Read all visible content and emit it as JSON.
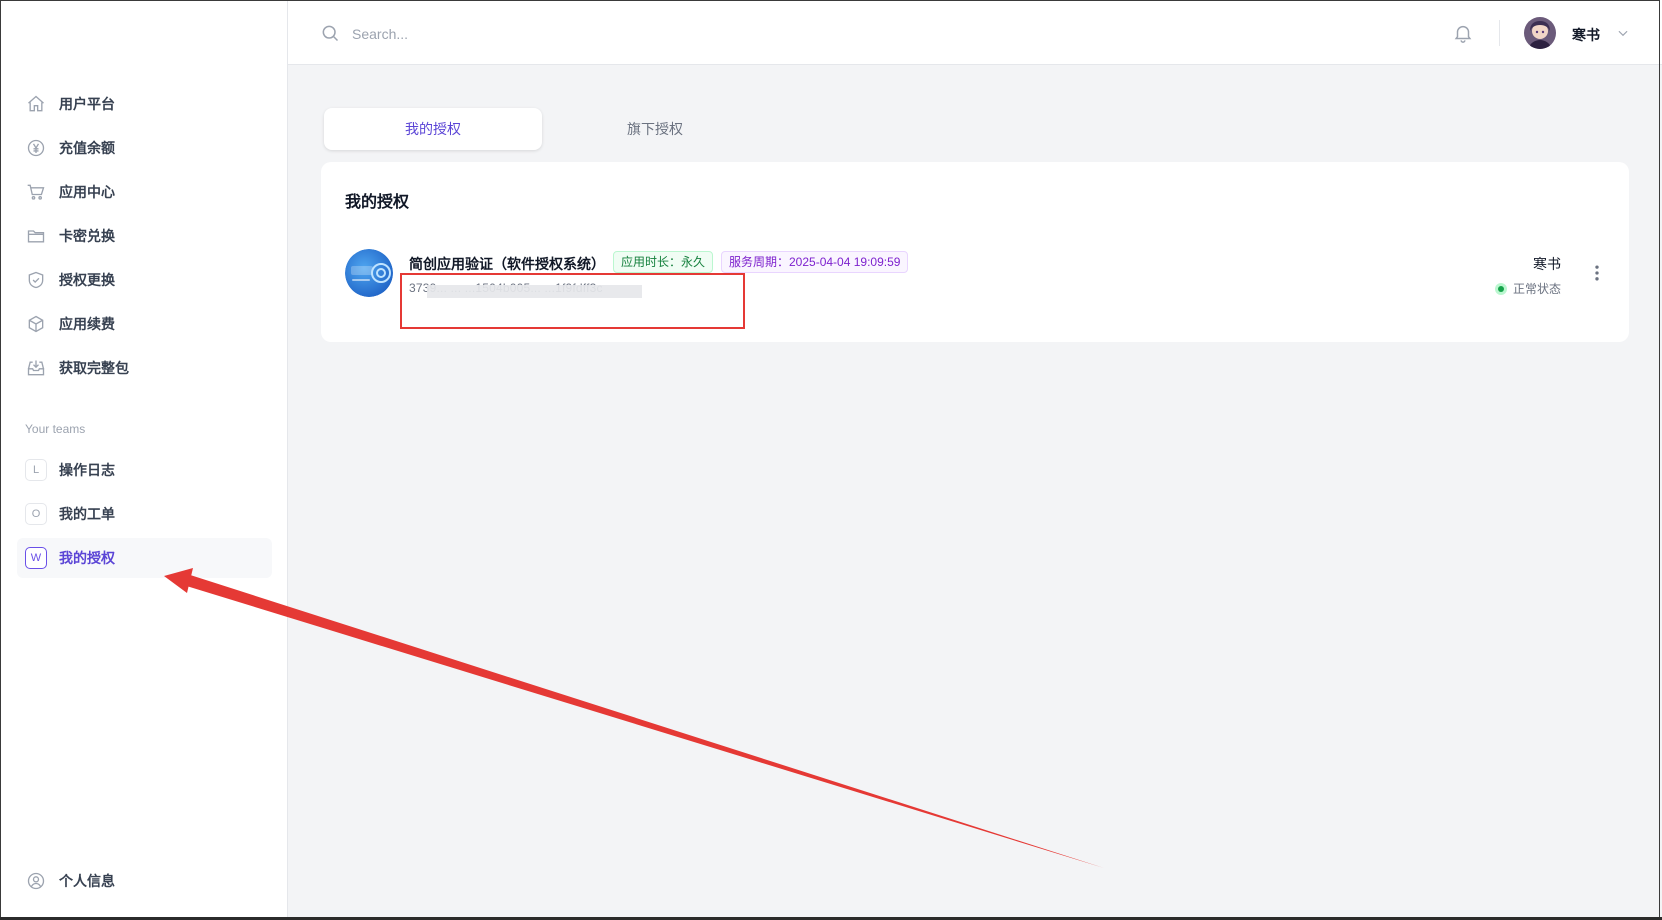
{
  "header": {
    "search_placeholder": "Search...",
    "username": "寒书"
  },
  "sidebar": {
    "items": [
      {
        "label": "用户平台",
        "icon": "home-icon"
      },
      {
        "label": "充值余额",
        "icon": "yen-icon"
      },
      {
        "label": "应用中心",
        "icon": "cart-icon"
      },
      {
        "label": "卡密兑换",
        "icon": "folder-icon"
      },
      {
        "label": "授权更换",
        "icon": "shield-check-icon"
      },
      {
        "label": "应用续费",
        "icon": "cube-icon"
      },
      {
        "label": "获取完整包",
        "icon": "inbox-download-icon"
      }
    ],
    "teams_title": "Your teams",
    "teams": [
      {
        "badge": "L",
        "label": "操作日志",
        "active": false
      },
      {
        "badge": "O",
        "label": "我的工单",
        "active": false
      },
      {
        "badge": "W",
        "label": "我的授权",
        "active": true
      }
    ],
    "profile_label": "个人信息"
  },
  "tabs": [
    {
      "label": "我的授权",
      "active": true
    },
    {
      "label": "旗下授权",
      "active": false
    }
  ],
  "card": {
    "title": "我的授权",
    "app_name": "简创应用验证（软件授权系统）",
    "tag_duration": "应用时长：永久",
    "tag_period": "服务周期：2025-04-04 19:09:59",
    "license_key": "3739... ...    ...1504b005...    ...1f9fdff3c",
    "owner": "寒书",
    "status": "正常状态"
  },
  "colors": {
    "accent": "#5b45d6",
    "annotation_red": "#e53935",
    "status_green": "#16a34a"
  }
}
